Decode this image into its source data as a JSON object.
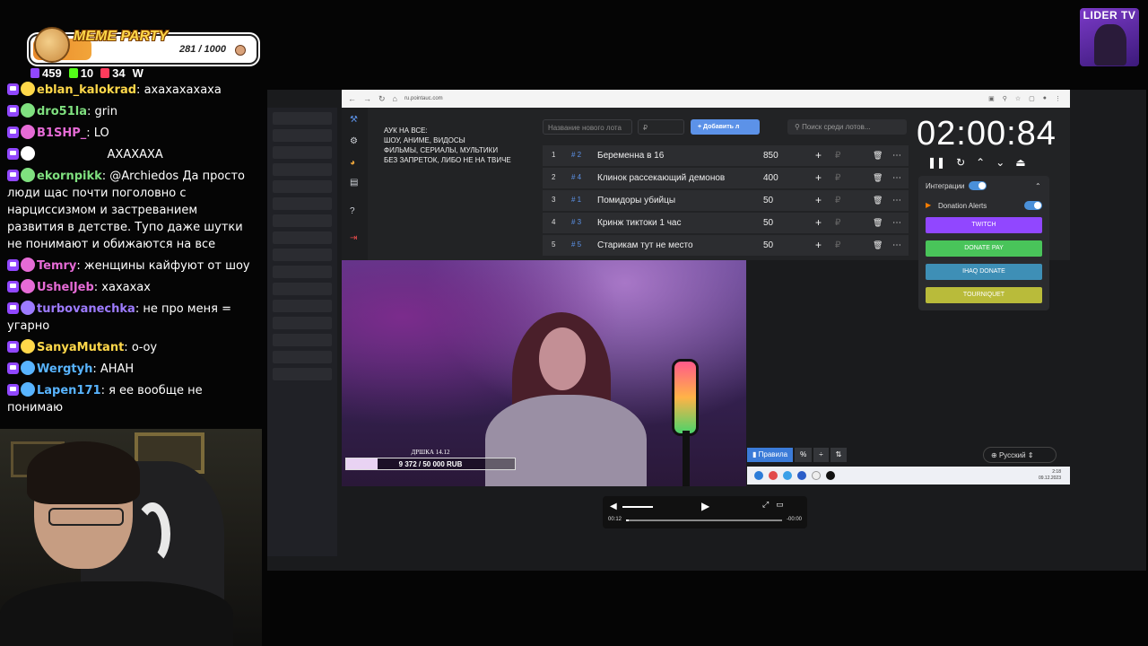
{
  "meme_party": {
    "title": "MEME PARTY",
    "count": "281 / 1000",
    "progress": 0.281
  },
  "stats": [
    {
      "icon": "twitch-viewers-icon",
      "value": "459",
      "color": "#9147ff"
    },
    {
      "icon": "kick-icon",
      "value": "10",
      "color": "#53fc18"
    },
    {
      "icon": "vk-live-icon",
      "value": "34",
      "color": "#ff3b5c"
    },
    {
      "icon": "w-icon",
      "value": "",
      "color": "#ffffff"
    }
  ],
  "chat": [
    {
      "user": "eblan_kalokrad",
      "color": "#ffd84a",
      "text": "ахахахахаха"
    },
    {
      "user": "dro51la",
      "color": "#7fe07f",
      "text": "grin"
    },
    {
      "user": "B1SHP_",
      "color": "#e66bd6",
      "text": "LO"
    },
    {
      "user": "",
      "color": "#ffffff",
      "text": "АХАХАХА"
    },
    {
      "user": "ekornpikk",
      "color": "#7fe07f",
      "text": "@Archiedos Да просто люди щас почти поголовно с нарциссизмом и застреванием развития в детстве. Тупо даже шутки не понимают и обижаются на все"
    },
    {
      "user": "Temry",
      "color": "#e66bd6",
      "text": "женщины кайфуют от шоу"
    },
    {
      "user": "UshelJeb",
      "color": "#e66bd6",
      "text": "хахахах"
    },
    {
      "user": "turbovanechka",
      "color": "#9d7bff",
      "text": "не про меня = угарно"
    },
    {
      "user": "SanyaMutant",
      "color": "#ffd84a",
      "text": "о-оу"
    },
    {
      "user": "Wergtyh",
      "color": "#58b4ff",
      "text": "АНАН"
    },
    {
      "user": "Lapen171",
      "color": "#58b4ff",
      "text": "я ее вообще не понимаю"
    }
  ],
  "lider": {
    "title": "LIDER TV"
  },
  "browser": {
    "url": "ru.pointauc.com",
    "description": [
      "АУК НА ВСЕ:",
      "ШОУ, АНИМЕ, ВИДОСЫ",
      "ФИЛЬМЫ, СЕРИАЛЫ, МУЛЬТИКИ",
      "БЕЗ ЗАПРЕТОК, ЛИБО НЕ НА ТВИЧЕ"
    ],
    "new_lot_placeholder": "Название нового лота",
    "amount_placeholder": "₽",
    "add_button": "Добавить л",
    "search_placeholder": "Поиск среди лотов...",
    "lots": [
      {
        "idx": "1",
        "fav": "# 2",
        "name": "Беременна в 16",
        "amount": "850"
      },
      {
        "idx": "2",
        "fav": "# 4",
        "name": "Клинок рассекающий демонов",
        "amount": "400"
      },
      {
        "idx": "3",
        "fav": "# 1",
        "name": "Помидоры убийцы",
        "amount": "50"
      },
      {
        "idx": "4",
        "fav": "# 3",
        "name": "Кринж тиктоки 1 час",
        "amount": "50"
      },
      {
        "idx": "5",
        "fav": "# 5",
        "name": "Старикам тут не место",
        "amount": "50"
      }
    ]
  },
  "timer": {
    "value": "02:00:84"
  },
  "integrations": {
    "label": "Интеграции",
    "donation_alerts": "Donation Alerts",
    "services": [
      {
        "label": "TWITCH",
        "color": "#9147ff"
      },
      {
        "label": "DONATE PAY",
        "color": "#49c45a"
      },
      {
        "label": "IHAQ DONATE",
        "color": "#3e8fb6"
      },
      {
        "label": "TOURNIQUET",
        "color": "#b9bb3a"
      }
    ]
  },
  "donation": {
    "name": "ДРШКА 14.12",
    "text": "9 372 / 50 000 RUB",
    "progress": 0.187
  },
  "bottom_bar": {
    "rules": "Правила",
    "language": "Русский",
    "time": "2:18",
    "date": "09.12.2023"
  },
  "player": {
    "current": "00:12",
    "remaining": "-00:00",
    "progress": 0.02
  }
}
